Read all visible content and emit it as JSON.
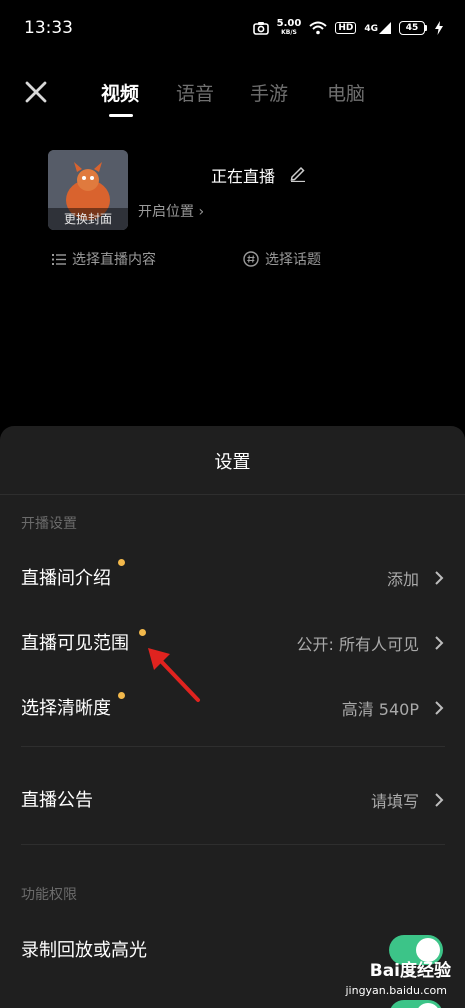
{
  "status_bar": {
    "time": "13:33",
    "speed_value": "5.00",
    "speed_unit": "KB/S",
    "hd": "HD",
    "network": "4G",
    "battery": "45"
  },
  "tabs": [
    {
      "label": "视频",
      "active": true
    },
    {
      "label": "语音",
      "active": false
    },
    {
      "label": "手游",
      "active": false
    },
    {
      "label": "电脑",
      "active": false
    }
  ],
  "cover": {
    "change_cover_label": "更换封面",
    "live_title": "正在直播",
    "location": "开启位置",
    "choose_content": "选择直播内容",
    "choose_topic": "选择话题"
  },
  "sheet": {
    "title": "设置",
    "section_open": "开播设置",
    "rows": [
      {
        "label": "直播间介绍",
        "value": "添加"
      },
      {
        "label": "直播可见范围",
        "value": "公开: 所有人可见"
      },
      {
        "label": "选择清晰度",
        "value": "高清 540P"
      },
      {
        "label": "直播公告",
        "value": "请填写"
      }
    ],
    "section_permissions": "功能权限",
    "toggle_row": {
      "label": "录制回放或高光",
      "enabled": true
    }
  },
  "watermark": {
    "logo": "Bai度经验",
    "url": "jingyan.baidu.com"
  },
  "colors": {
    "accent_green": "#3cc488",
    "dot_orange": "#f2b84b",
    "arrow_red": "#e0231f"
  }
}
